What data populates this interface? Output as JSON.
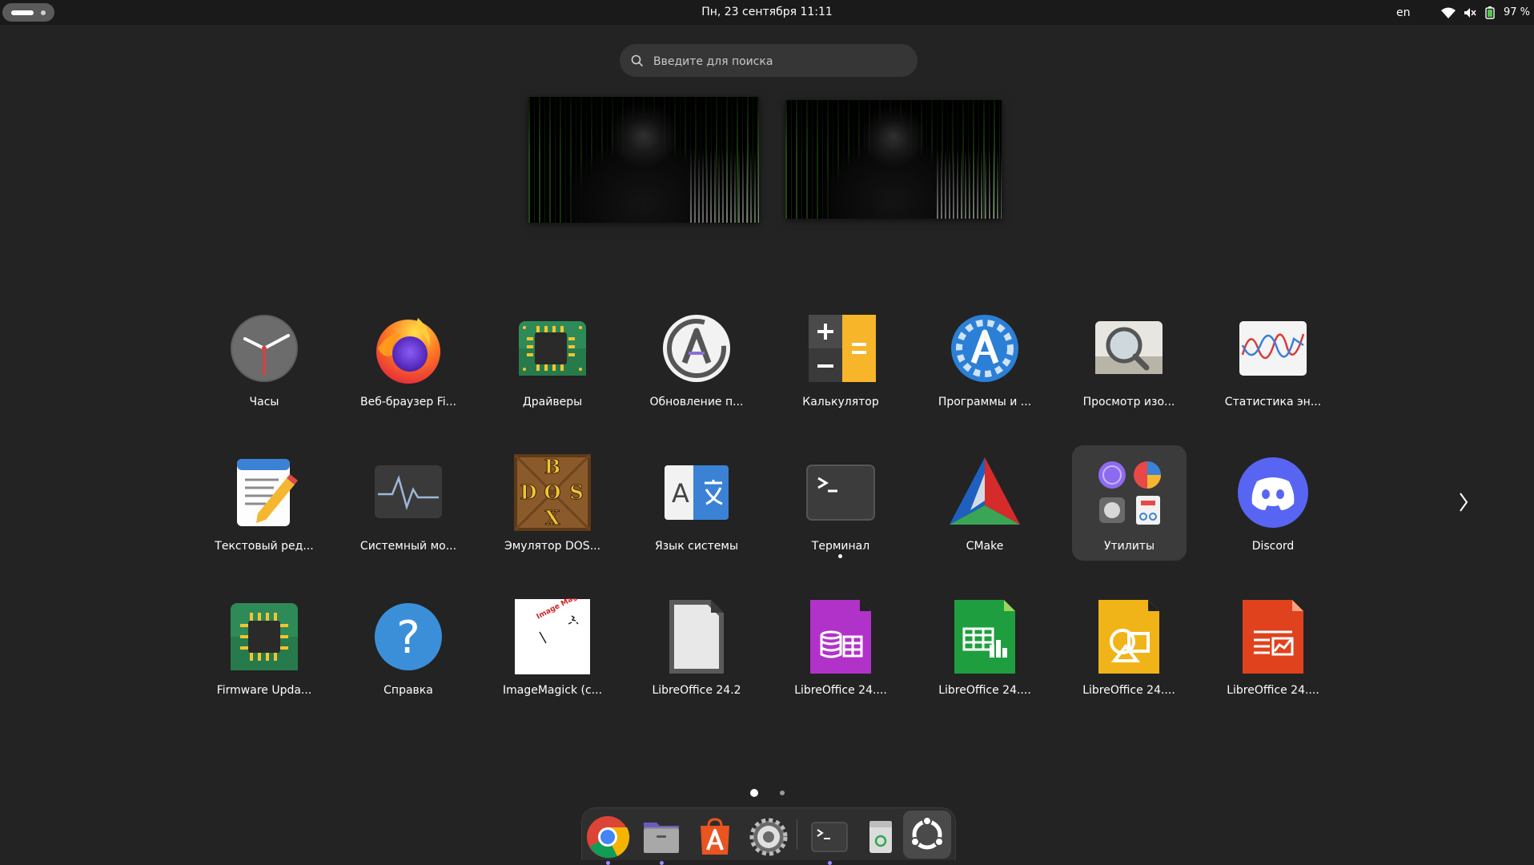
{
  "topbar": {
    "datetime": "Пн, 23 сентября  11:11",
    "language": "en",
    "battery": "97 %"
  },
  "search": {
    "placeholder": "Введите для поиска"
  },
  "apps": [
    {
      "label": "Часы",
      "icon": "clock-icon"
    },
    {
      "label": "Веб-браузер Fi...",
      "icon": "firefox-icon"
    },
    {
      "label": "Драйверы",
      "icon": "chip-icon"
    },
    {
      "label": "Обновление п...",
      "icon": "software-updater-icon"
    },
    {
      "label": "Калькулятор",
      "icon": "calculator-icon"
    },
    {
      "label": "Программы и ...",
      "icon": "software-properties-icon"
    },
    {
      "label": "Просмотр изо...",
      "icon": "image-viewer-icon"
    },
    {
      "label": "Статистика эн...",
      "icon": "power-statistics-icon"
    },
    {
      "label": "Текстовый ред...",
      "icon": "text-editor-icon"
    },
    {
      "label": "Системный мо...",
      "icon": "system-monitor-icon"
    },
    {
      "label": "Эмулятор DOS...",
      "icon": "dosbox-icon"
    },
    {
      "label": "Язык системы",
      "icon": "language-icon"
    },
    {
      "label": "Терминал",
      "icon": "terminal-icon"
    },
    {
      "label": "CMake",
      "icon": "cmake-icon"
    },
    {
      "label": "Утилиты",
      "icon": "folder-icon"
    },
    {
      "label": "Discord",
      "icon": "discord-icon"
    },
    {
      "label": "Firmware Upda...",
      "icon": "firmware-icon"
    },
    {
      "label": "Справка",
      "icon": "help-icon"
    },
    {
      "label": "ImageMagick (c...",
      "icon": "imagemagick-icon"
    },
    {
      "label": "LibreOffice 24.2",
      "icon": "libreoffice-icon"
    },
    {
      "label": "LibreOffice 24....",
      "icon": "libreoffice-base-icon"
    },
    {
      "label": "LibreOffice 24....",
      "icon": "libreoffice-calc-icon"
    },
    {
      "label": "LibreOffice 24....",
      "icon": "libreoffice-draw-icon"
    },
    {
      "label": "LibreOffice 24....",
      "icon": "libreoffice-impress-icon"
    }
  ],
  "imagemagick_text": "Image Magick",
  "dosbox_text": [
    "B",
    "D",
    "O",
    "S",
    "X"
  ],
  "dock": [
    {
      "icon": "chrome-icon"
    },
    {
      "icon": "files-icon"
    },
    {
      "icon": "app-center-icon"
    },
    {
      "icon": "settings-icon"
    },
    {
      "icon": "terminal-icon"
    },
    {
      "icon": "trash-icon"
    },
    {
      "icon": "show-apps-icon"
    }
  ],
  "colors": {
    "background": "#232323",
    "accent": "#9d87ff",
    "ubuntu_orange": "#E95420"
  }
}
